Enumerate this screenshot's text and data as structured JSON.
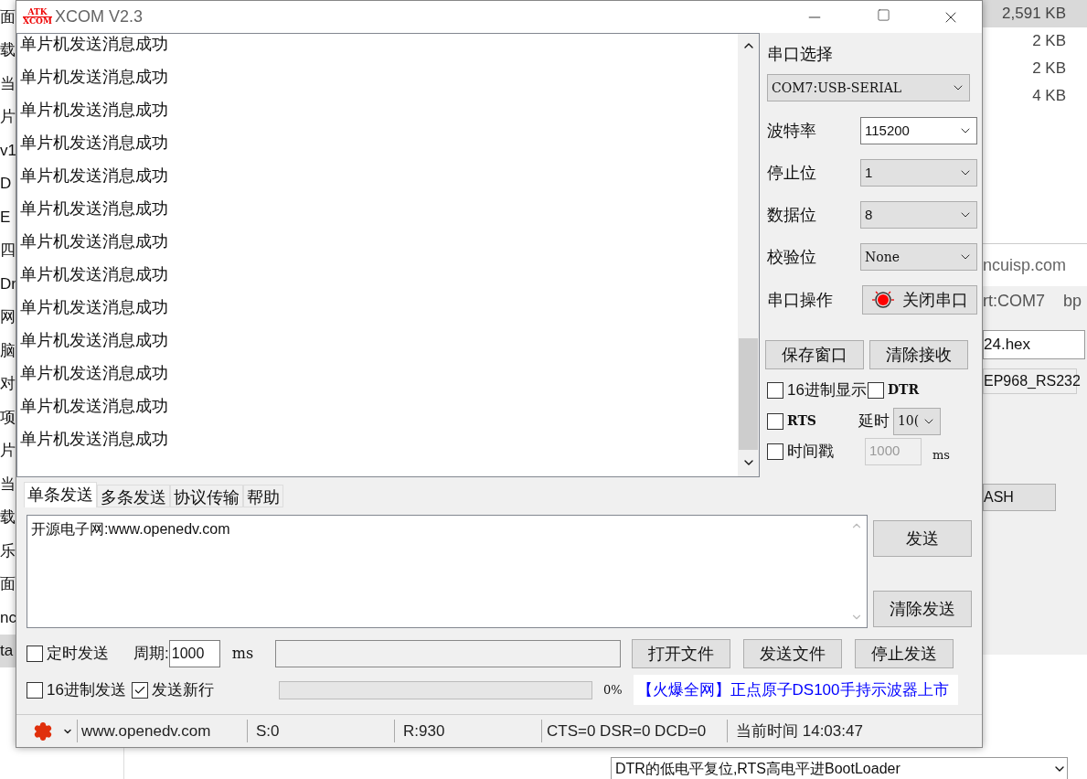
{
  "background": {
    "left_fragments": [
      "面",
      "载",
      "当",
      "片",
      "v1",
      "D",
      "E",
      "四",
      "Dr",
      "网",
      "脑",
      "对",
      "项",
      "片",
      "当",
      "载",
      "乐",
      "面",
      "nc",
      "ta"
    ],
    "file_sizes": [
      "2,591 KB",
      "2 KB",
      "2 KB",
      "4 KB"
    ],
    "site": "ncuisp.com",
    "port": "rt:COM7",
    "baud": "bp",
    "file": "24.hex",
    "tab": "EP968_RS232",
    "button": "ASH",
    "hint": "DTR的低电平复位,RTS高电平进BootLoader"
  },
  "window": {
    "logo": [
      "ATK",
      "XCOM"
    ],
    "title": "XCOM V2.3"
  },
  "receive": {
    "lines": [
      "单片机发送消息成功",
      "单片机发送消息成功",
      "单片机发送消息成功",
      "单片机发送消息成功",
      "单片机发送消息成功",
      "单片机发送消息成功",
      "单片机发送消息成功",
      "单片机发送消息成功",
      "单片机发送消息成功",
      "单片机发送消息成功",
      "单片机发送消息成功",
      "单片机发送消息成功",
      "单片机发送消息成功"
    ]
  },
  "settings": {
    "port_label": "串口选择",
    "port": "COM7:USB-SERIAL",
    "fields": [
      {
        "label": "波特率",
        "value": "115200",
        "focused": true
      },
      {
        "label": "停止位",
        "value": "1",
        "focused": false
      },
      {
        "label": "数据位",
        "value": "8",
        "focused": false
      },
      {
        "label": "校验位",
        "value": "None",
        "focused": false
      }
    ],
    "operation_label": "串口操作",
    "operation_button": "关闭串口",
    "port_open": true,
    "buttons": [
      "保存窗口",
      "清除接收"
    ],
    "hex_display": {
      "label": "16进制显示",
      "checked": false
    },
    "dtr": {
      "label": "DTR",
      "checked": false
    },
    "rts": {
      "label": "RTS",
      "checked": false
    },
    "delay_label": "延时",
    "delay": "10(",
    "timestamp": {
      "label": "时间戳",
      "checked": false
    },
    "timestamp_value": "1000",
    "timestamp_unit": "ms"
  },
  "tabs": [
    {
      "label": "单条发送",
      "selected": true
    },
    {
      "label": "多条发送",
      "selected": false
    },
    {
      "label": "协议传输",
      "selected": false
    },
    {
      "label": "帮助",
      "selected": false
    }
  ],
  "send": {
    "text": "开源电子网:www.openedv.com",
    "buttons": [
      "发送",
      "清除发送"
    ]
  },
  "timed_send": {
    "label": "定时发送",
    "checked": false
  },
  "period_label": "周期:",
  "period": "1000",
  "period_unit": "ms",
  "file_buttons": [
    "打开文件",
    "发送文件",
    "停止发送"
  ],
  "hex_send": {
    "label": "16进制发送",
    "checked": false
  },
  "new_line": {
    "label": "发送新行",
    "checked": true
  },
  "progress": {
    "level": 0
  },
  "progress_text": "0%",
  "ad": "【火爆全网】正点原子DS100手持示波器上市",
  "status_bar": {
    "link": "www.openedv.com",
    "sent": "S:0",
    "received": "R:930",
    "lines": "CTS=0 DSR=0 DCD=0",
    "time": "当前时间 14:03:47"
  }
}
